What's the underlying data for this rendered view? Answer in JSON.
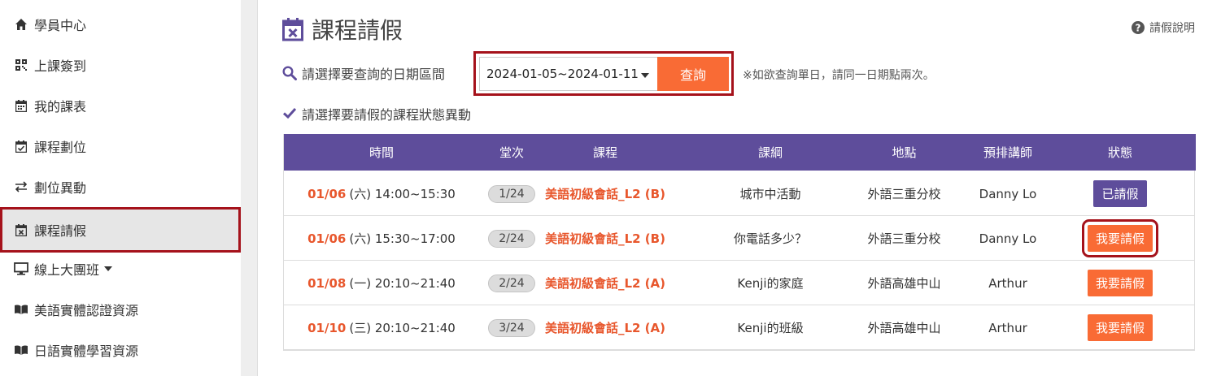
{
  "sidebar": {
    "items": [
      {
        "label": "學員中心",
        "icon": "home-icon"
      },
      {
        "label": "上課簽到",
        "icon": "qrcode-icon"
      },
      {
        "label": "我的課表",
        "icon": "calendar-icon"
      },
      {
        "label": "課程劃位",
        "icon": "calendar-check-icon"
      },
      {
        "label": "劃位異動",
        "icon": "exchange-icon"
      },
      {
        "label": "課程請假",
        "icon": "calendar-x-icon",
        "active": true
      },
      {
        "label": "線上大團班",
        "icon": "monitor-icon"
      },
      {
        "label": "美語實體認證資源",
        "icon": "book-icon"
      },
      {
        "label": "日語實體學習資源",
        "icon": "book-icon"
      }
    ]
  },
  "page": {
    "title": "課程請假",
    "help": "請假說明",
    "date_label": "請選擇要查詢的日期區間",
    "date_range": "2024-01-05~2024-01-11",
    "query_button": "查詢",
    "note": "※如欲查詢單日，請同一日期點兩次。",
    "status_label": "請選擇要請假的課程狀態異動"
  },
  "table": {
    "headers": [
      "時間",
      "堂次",
      "課程",
      "課綱",
      "地點",
      "預排講師",
      "狀態"
    ],
    "rows": [
      {
        "date": "01/06",
        "rest": "(六) 14:00~15:30",
        "session": "1/24",
        "course": "美語初級會話_L2 (B)",
        "syllabus": "城市中活動",
        "location": "外語三重分校",
        "teacher": "Danny Lo",
        "status": "已請假"
      },
      {
        "date": "01/06",
        "rest": "(六) 15:30~17:00",
        "session": "2/24",
        "course": "美語初級會話_L2 (B)",
        "syllabus": "你電話多少？",
        "location": "外語三重分校",
        "teacher": "Danny Lo",
        "status": "我要請假"
      },
      {
        "date": "01/08",
        "rest": "(一) 20:10~21:40",
        "session": "2/24",
        "course": "美語初級會話_L2 (A)",
        "syllabus": "Kenji的家庭",
        "location": "外語高雄中山",
        "teacher": "Arthur",
        "status": "我要請假"
      },
      {
        "date": "01/10",
        "rest": "(三) 20:10~21:40",
        "session": "3/24",
        "course": "美語初級會話_L2 (A)",
        "syllabus": "Kenji的班級",
        "location": "外語高雄中山",
        "teacher": "Arthur",
        "status": "我要請假"
      }
    ]
  },
  "colors": {
    "accent": "#f96b35",
    "purple": "#5e4d9b",
    "highlight": "#a5121b"
  }
}
